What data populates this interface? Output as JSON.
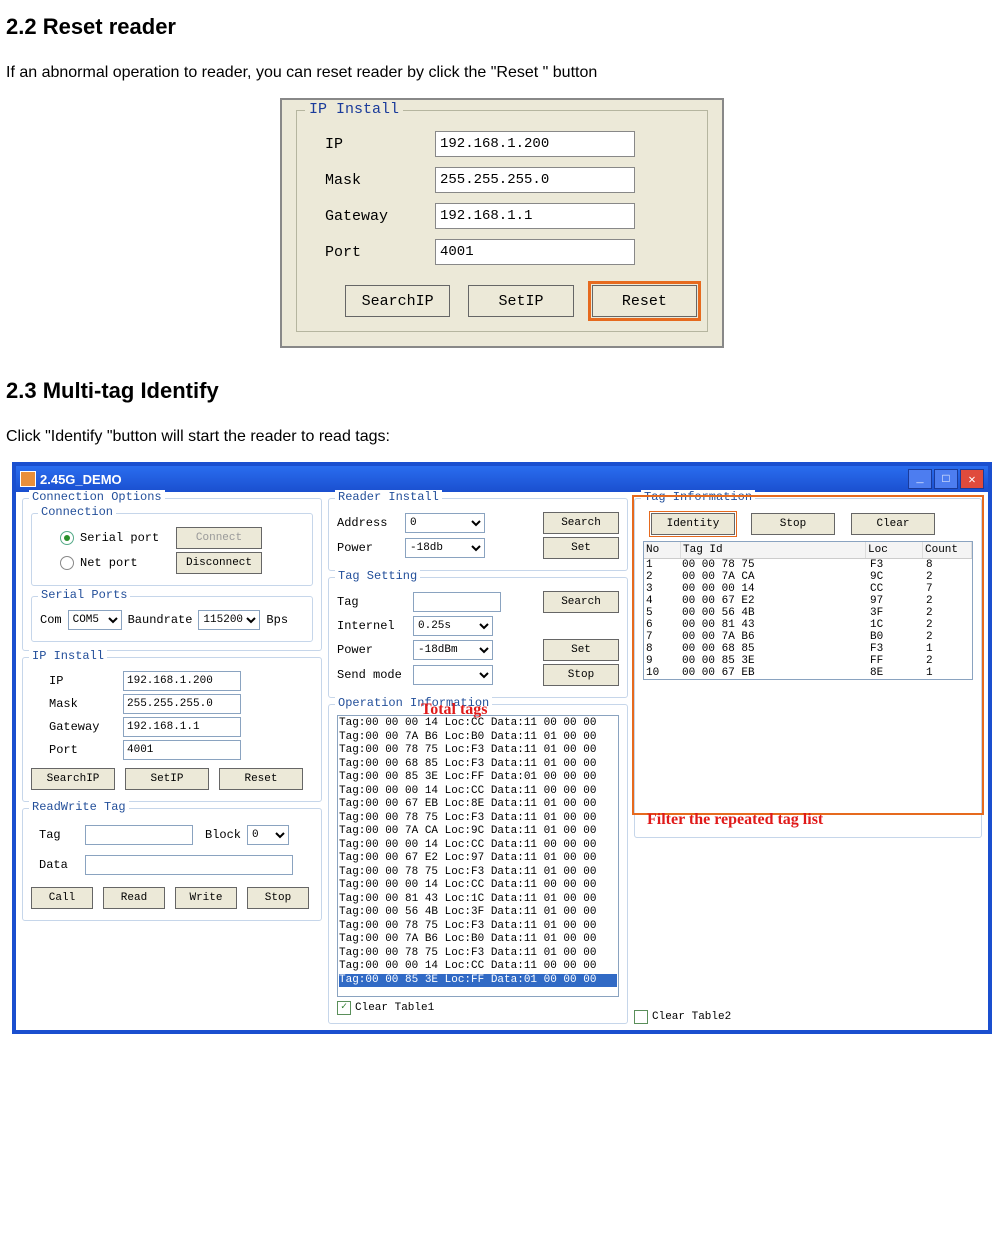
{
  "doc": {
    "h22": "2.2    Reset reader",
    "p22": "If an abnormal operation to reader, you can reset reader by click the \"Reset \" button",
    "h23": "2.3    Multi-tag Identify",
    "p23": "Click \"Identify \"button will start the reader to read tags:"
  },
  "ipinstall1": {
    "title": "IP Install",
    "ip_label": "IP",
    "ip_value": "192.168.1.200",
    "mask_label": "Mask",
    "mask_value": "255.255.255.0",
    "gw_label": "Gateway",
    "gw_value": "192.168.1.1",
    "port_label": "Port",
    "port_value": "4001",
    "btn_search": "SearchIP",
    "btn_set": "SetIP",
    "btn_reset": "Reset"
  },
  "win2": {
    "title": "2.45G_DEMO",
    "connopt_title": "Connection Options",
    "conn_title": "Connection",
    "conn_serial": "Serial port",
    "conn_net": "Net port",
    "btn_connect": "Connect",
    "btn_disconnect": "Disconnect",
    "serialports_title": "Serial Ports",
    "com_label": "Com",
    "com_value": "COM5",
    "baud_label": "Baundrate",
    "baud_value": "115200",
    "bps": "Bps",
    "ipinstall_title": "IP Install",
    "ip_label": "IP",
    "ip_value": "192.168.1.200",
    "mask_label": "Mask",
    "mask_value": "255.255.255.0",
    "gw_label": "Gateway",
    "gw_value": "192.168.1.1",
    "port_label": "Port",
    "port_value": "4001",
    "btn_searchip": "SearchIP",
    "btn_setip": "SetIP",
    "btn_reset": "Reset",
    "rwtag_title": "ReadWrite Tag",
    "tag_label": "Tag",
    "block_label": "Block",
    "block_value": "0",
    "data_label": "Data",
    "btn_call": "Call",
    "btn_read": "Read",
    "btn_write": "Write",
    "btn_stop": "Stop",
    "readerinst_title": "Reader Install",
    "addr_label": "Address",
    "addr_value": "0",
    "btn_search": "Search",
    "power_label": "Power",
    "power_value": "-18db",
    "btn_set": "Set",
    "tagset_title": "Tag Setting",
    "ts_tag_label": "Tag",
    "ts_internel_label": "Internel",
    "ts_internel_value": "0.25s",
    "ts_power_label": "Power",
    "ts_power_value": "-18dBm",
    "ts_sendmode_label": "Send mode",
    "ts_btn_search": "Search",
    "ts_btn_set": "Set",
    "ts_btn_stop": "Stop",
    "opinfo_title": "Operation Information",
    "opinfo_lines": [
      "Tag:00 00 00 14 Loc:CC Data:11 00 00 00",
      "Tag:00 00 7A B6 Loc:B0 Data:11 01 00 00",
      "Tag:00 00 78 75 Loc:F3 Data:11 01 00 00",
      "Tag:00 00 68 85 Loc:F3 Data:11 01 00 00",
      "Tag:00 00 85 3E Loc:FF Data:01 00 00 00",
      "Tag:00 00 00 14 Loc:CC Data:11 00 00 00",
      "Tag:00 00 67 EB Loc:8E Data:11 01 00 00",
      "Tag:00 00 78 75 Loc:F3 Data:11 01 00 00",
      "Tag:00 00 7A CA Loc:9C Data:11 01 00 00",
      "Tag:00 00 00 14 Loc:CC Data:11 00 00 00",
      "Tag:00 00 67 E2 Loc:97 Data:11 01 00 00",
      "Tag:00 00 78 75 Loc:F3 Data:11 01 00 00",
      "Tag:00 00 00 14 Loc:CC Data:11 00 00 00",
      "Tag:00 00 81 43 Loc:1C Data:11 01 00 00",
      "Tag:00 00 56 4B Loc:3F Data:11 01 00 00",
      "Tag:00 00 78 75 Loc:F3 Data:11 01 00 00",
      "Tag:00 00 7A B6 Loc:B0 Data:11 01 00 00",
      "Tag:00 00 78 75 Loc:F3 Data:11 01 00 00",
      "Tag:00 00 00 14 Loc:CC Data:11 00 00 00",
      "Tag:00 00 85 3E Loc:FF Data:01 00 00 00"
    ],
    "clear_table1": "Clear Table1",
    "taginfo_title": "Tag Information",
    "btn_identity": "Identity",
    "btn_stop2": "Stop",
    "btn_clear": "Clear",
    "th_no": "No",
    "th_tagid": "Tag Id",
    "th_loc": "Loc",
    "th_count": "Count",
    "tagrows": [
      {
        "no": "1",
        "id": "00 00 78 75",
        "loc": "F3",
        "cnt": "8"
      },
      {
        "no": "2",
        "id": "00 00 7A CA",
        "loc": "9C",
        "cnt": "2"
      },
      {
        "no": "3",
        "id": "00 00 00 14",
        "loc": "CC",
        "cnt": "7"
      },
      {
        "no": "4",
        "id": "00 00 67 E2",
        "loc": "97",
        "cnt": "2"
      },
      {
        "no": "5",
        "id": "00 00 56 4B",
        "loc": "3F",
        "cnt": "2"
      },
      {
        "no": "6",
        "id": "00 00 81 43",
        "loc": "1C",
        "cnt": "2"
      },
      {
        "no": "7",
        "id": "00 00 7A B6",
        "loc": "B0",
        "cnt": "2"
      },
      {
        "no": "8",
        "id": "00 00 68 85",
        "loc": "F3",
        "cnt": "1"
      },
      {
        "no": "9",
        "id": "00 00 85 3E",
        "loc": "FF",
        "cnt": "2"
      },
      {
        "no": "10",
        "id": "00 00 67 EB",
        "loc": "8E",
        "cnt": "1"
      }
    ],
    "clear_table2": "Clear Table2",
    "annot_total": "Total tags",
    "annot_filter": "Filter the repeated tag list"
  }
}
